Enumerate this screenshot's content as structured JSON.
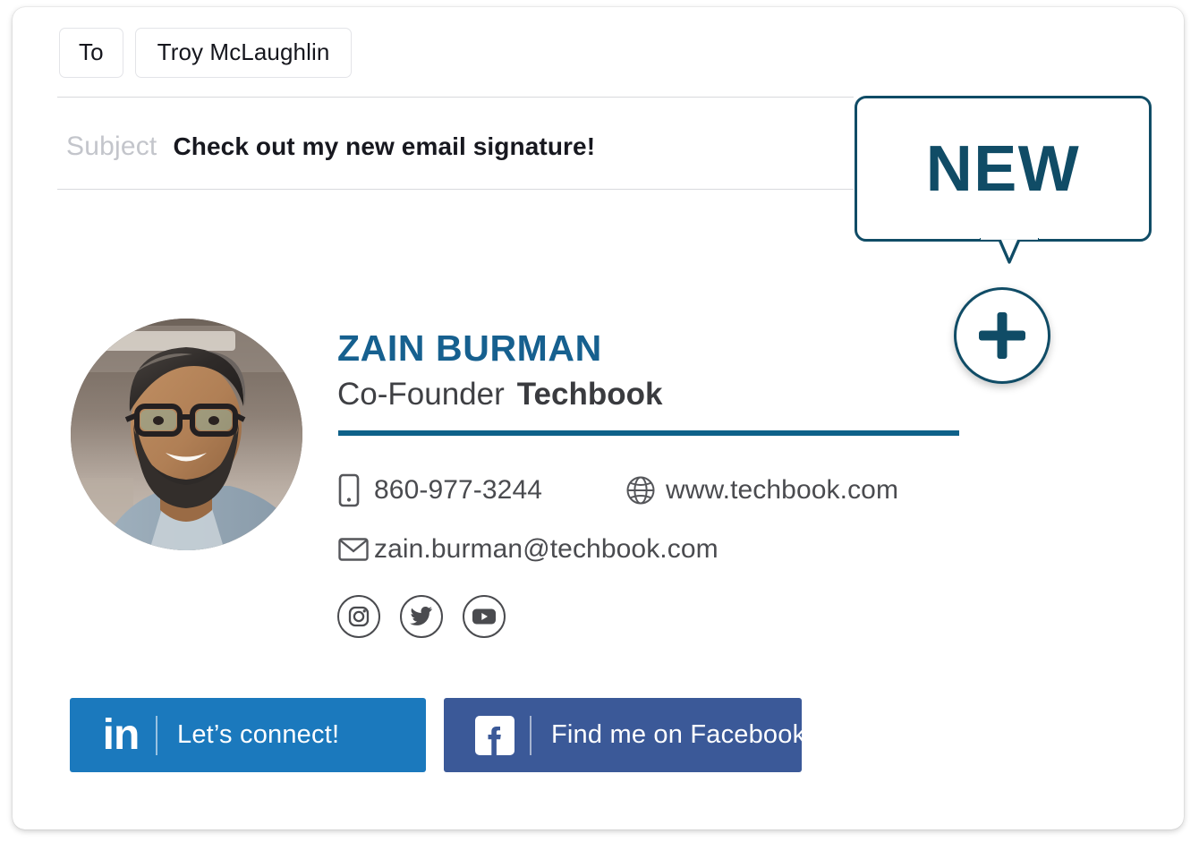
{
  "compose": {
    "to_label": "To",
    "recipient": "Troy McLaughlin",
    "subject_label": "Subject",
    "subject_value": "Check out my new email signature!"
  },
  "callout": {
    "text": "NEW",
    "border_color": "#104c66"
  },
  "add_button": {
    "icon": "plus-icon",
    "color": "#104c66"
  },
  "signature": {
    "avatar_alt": "portrait-photo",
    "name": "ZAIN BURMAN",
    "name_color": "#16608f",
    "job_title": "Co-Founder",
    "company": "Techbook",
    "rule_color": "#0e6189",
    "contacts": [
      {
        "icon": "mobile-phone-icon",
        "text": "860-977-3244",
        "type": "phone"
      },
      {
        "icon": "globe-icon",
        "text": "www.techbook.com",
        "type": "website"
      },
      {
        "icon": "envelope-icon",
        "text": "zain.burman@techbook.com",
        "type": "email"
      }
    ],
    "socials": [
      {
        "icon": "instagram-icon",
        "name": "Instagram"
      },
      {
        "icon": "twitter-icon",
        "name": "Twitter"
      },
      {
        "icon": "youtube-icon",
        "name": "YouTube"
      }
    ],
    "cta": [
      {
        "icon": "linkedin-icon",
        "label": "Let’s connect!",
        "color": "#1b79bd"
      },
      {
        "icon": "facebook-icon",
        "label": "Find me on Facebook",
        "color": "#3b5998"
      }
    ]
  }
}
